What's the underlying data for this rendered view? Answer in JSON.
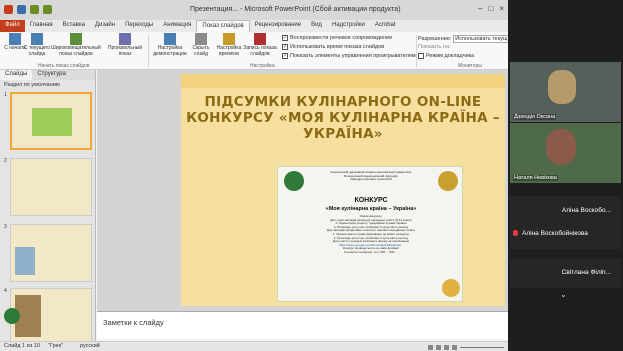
{
  "window": {
    "title": "Презентация... - Microsoft PowerPoint (Сбой активации продукта)",
    "controls": [
      "–",
      "□",
      "×"
    ]
  },
  "ribbon_tabs": [
    "Файл",
    "Главная",
    "Вставка",
    "Дизайн",
    "Переходы",
    "Анимация",
    "Показ слайдов",
    "Рецензирование",
    "Вид",
    "Надстройки",
    "Acrobat"
  ],
  "ribbon": {
    "buttons": [
      {
        "label": "С начала"
      },
      {
        "label": "С текущего слайда"
      },
      {
        "label": "Широковещательный показ слайдов"
      },
      {
        "label": "Произвольный показ"
      },
      {
        "label": "Настройка демонстрации"
      },
      {
        "label": "Скрыть слайд"
      },
      {
        "label": "Настройка времени"
      },
      {
        "label": "Запись показа слайдов"
      }
    ],
    "group_start": "Начать показ слайдов",
    "group_setup": "Настройка",
    "group_monitors": "Мониторы",
    "checkboxes": [
      {
        "label": "Воспроизвести речевое сопровождение",
        "checked": "✓"
      },
      {
        "label": "Использовать время показа слайдов",
        "checked": "✓"
      },
      {
        "label": "Показать элементы управления проигрывателем",
        "checked": "✓"
      }
    ],
    "resolution_label": "Разрешение:",
    "resolution_value": "Использовать текущ...",
    "show_on_label": "Показать на:",
    "presenter_view": "Режим докладчика"
  },
  "left_panel": {
    "tabs": [
      "Слайды",
      "Структура"
    ],
    "section_label": "Раздел по умолчанию",
    "slide_numbers": [
      "1",
      "2",
      "3",
      "4"
    ]
  },
  "slide": {
    "title": "ПІДСУМКИ КУЛІНАРНОГО ON-LINE КОНКУРСУ «МОЯ КУЛІНАРНА КРАЇНА – УКРАЇНА»",
    "poster": {
      "header_lines": [
        "Херсонський державний аграрно-економічний університет",
        "Білозерський відокремлений підрозділ",
        "Кафедра харчових технологій"
      ],
      "heading": "КОНКУРС",
      "subheading": "«Моя кулінарна країна – Україна»",
      "body_lines": [
        "Умови конкурсу:",
        "Для учнів закладів загальної середньої освіти (8-11 класи)",
        "1. Презентація рецепту традиційної страви України",
        "2. Розповідь (есе) про особливості кухні свого регіону",
        "Для закладів професійно-технічної, фахової передвищої освіти",
        "1. Презентувати страву (відповідно до вимог конкурсу)",
        "2. Розповідь (есе) про особливості кухні свого регіону",
        "Для участі у конкурсі заповнити форму за посиланням",
        "https://docs.google.com/forms/d/e/1FAIpQLSd...",
        "Конкурс проводиться в он-лайн форматі",
        "Контактні телефони: тел. 096 ... 050 ..."
      ]
    }
  },
  "notes_placeholder": "Заметки к слайду",
  "statusbar": {
    "slide_counter": "Слайд 1 из 10",
    "theme": "\"Грек\"",
    "language": "русский"
  },
  "participants": {
    "videos": [
      {
        "name": "Дзюндія Оксана"
      },
      {
        "name": "Наталя Новікова"
      }
    ],
    "tiles": [
      {
        "name": "Аліна Воскобо...",
        "mic_muted": false
      },
      {
        "name": "Аліна Воскобойнікова",
        "mic_muted": true
      },
      {
        "name": "Світлана Філіп...",
        "mic_muted": false
      }
    ],
    "expand_icon": "chevron-down-icon"
  }
}
